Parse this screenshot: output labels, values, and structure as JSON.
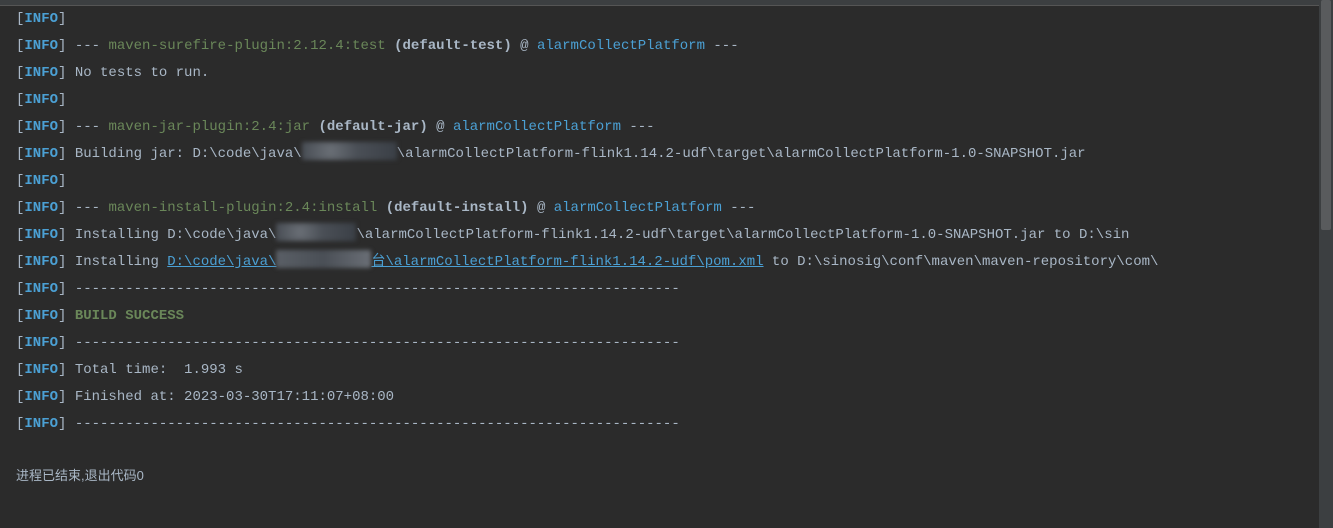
{
  "lines": [
    {
      "type": "info_only"
    },
    {
      "type": "plugin",
      "plugin": "maven-surefire-plugin:2.12.4:test",
      "exec": "(default-test)",
      "project": "alarmCollectPlatform"
    },
    {
      "type": "msg",
      "text": "No tests to run."
    },
    {
      "type": "info_only"
    },
    {
      "type": "plugin",
      "plugin": "maven-jar-plugin:2.4:jar",
      "exec": "(default-jar)",
      "project": "alarmCollectPlatform"
    },
    {
      "type": "jar_build",
      "prefix": "Building jar: D:\\code\\java\\",
      "suffix": "\\alarmCollectPlatform-flink1.14.2-udf\\target\\alarmCollectPlatform-1.0-SNAPSHOT.jar"
    },
    {
      "type": "info_only"
    },
    {
      "type": "plugin",
      "plugin": "maven-install-plugin:2.4:install",
      "exec": "(default-install)",
      "project": "alarmCollectPlatform"
    },
    {
      "type": "install1",
      "prefix": "Installing D:\\code\\java\\",
      "suffix": "\\alarmCollectPlatform-flink1.14.2-udf\\target\\alarmCollectPlatform-1.0-SNAPSHOT.jar to D:\\sin"
    },
    {
      "type": "install2",
      "prefix": "Installing ",
      "link_a": "D:\\code\\java\\",
      "link_b": "台\\alarmCollectPlatform-flink1.14.2-udf\\pom.xml",
      "suffix": " to D:\\sinosig\\conf\\maven\\maven-repository\\com\\"
    },
    {
      "type": "sep"
    },
    {
      "type": "success",
      "text": "BUILD SUCCESS"
    },
    {
      "type": "sep"
    },
    {
      "type": "msg",
      "text": "Total time:  1.993 s"
    },
    {
      "type": "msg",
      "text": "Finished at: 2023-03-30T17:11:07+08:00"
    },
    {
      "type": "sep"
    }
  ],
  "info_label": "INFO",
  "dashes": "---",
  "at": "@",
  "separator": "------------------------------------------------------------------------",
  "footer": "进程已结束,退出代码0"
}
